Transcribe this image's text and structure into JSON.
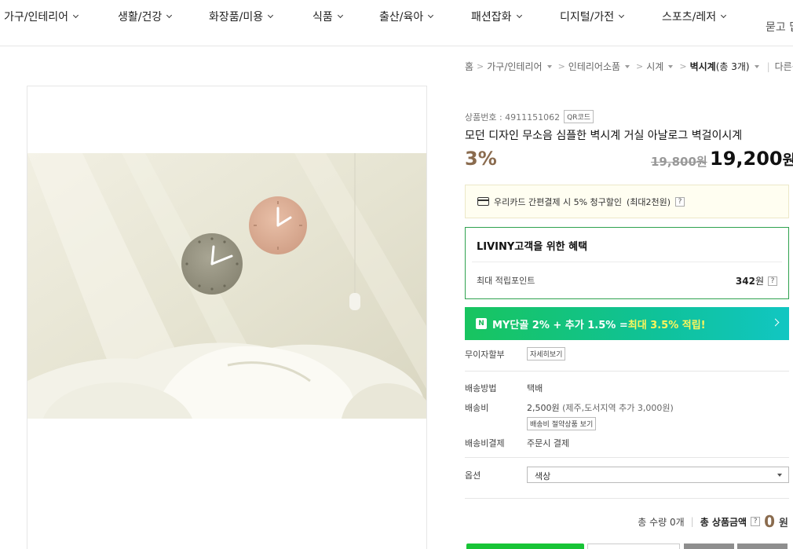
{
  "nav": {
    "items": [
      {
        "label": "가구/인테리어"
      },
      {
        "label": "생활/건강"
      },
      {
        "label": "화장품/미용"
      },
      {
        "label": "식품"
      },
      {
        "label": "출산/육아"
      },
      {
        "label": "패션잡화"
      },
      {
        "label": "디지털/가전"
      },
      {
        "label": "스포츠/레저"
      }
    ],
    "extra": "묻고 답"
  },
  "breadcrumb": {
    "home": "홈",
    "level1": "가구/인테리어",
    "level2": "인테리어소품",
    "level3": "시계",
    "current": "벽시계",
    "current_count": "(총 3개)",
    "other": "다른상"
  },
  "product": {
    "no_label": "상품번호 : 4911151062",
    "qr_label": "QR코드",
    "title": "모던 디자인 무소음 심플한 벽시계 거실 아날로그 벽걸이시계",
    "discount": "3%",
    "price_original": "19,800원",
    "price_now": "19,200",
    "price_unit": "원"
  },
  "card_promo": {
    "text": "우리카드 간편결제 시 5% 청구할인",
    "note": "(최대2천원)",
    "help": "?"
  },
  "benefit": {
    "title": "LIVINY고객을 위한 혜택",
    "point_label": "최대 적립포인트",
    "point_value": "342",
    "point_unit": "원",
    "help": "?"
  },
  "my_banner": {
    "badge": "N",
    "text": "MY단골 2% + 추가 1.5% = ",
    "highlight": "최대 3.5% 적립!"
  },
  "installment": {
    "label": "무이자할부",
    "button": "자세히보기"
  },
  "shipping": {
    "method_label": "배송방법",
    "method_value": "택배",
    "fee_label": "배송비",
    "fee_value": "2,500원",
    "fee_note": "(제주,도서지역 추가 3,000원)",
    "fee_button": "배송비 절약상품 보기",
    "payment_label": "배송비결제",
    "payment_value": "주문시 결제"
  },
  "option": {
    "label": "옵션",
    "placeholder": "색상"
  },
  "total": {
    "quantity": "총 수량 0개",
    "amount_label": "총 상품금액",
    "help": "?",
    "amount": "0",
    "amount_unit": "원"
  },
  "colors": {
    "accent_brown": "#8a6b4e",
    "benefit_border": "#2fa24f",
    "buy_button": "#18c436"
  }
}
